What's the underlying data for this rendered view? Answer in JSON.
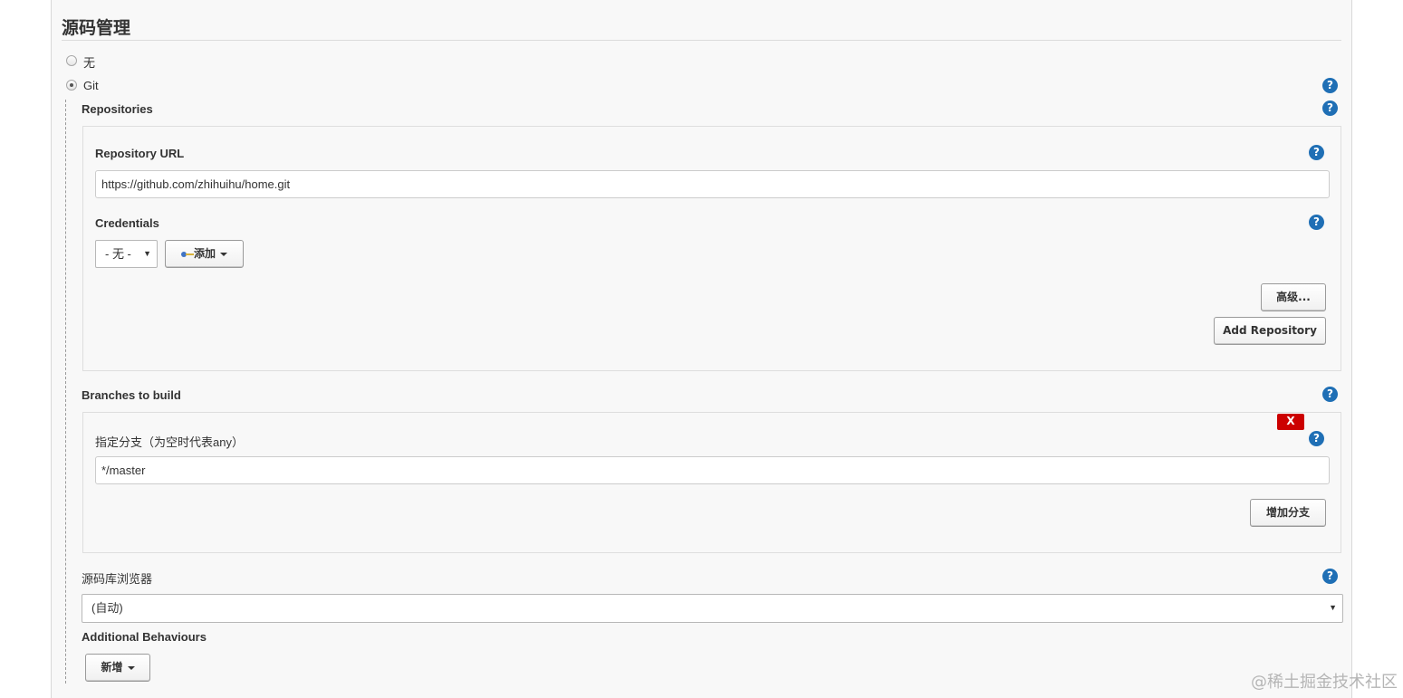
{
  "section": {
    "title": "源码管理"
  },
  "scm": {
    "options": [
      {
        "label": "无",
        "selected": false
      },
      {
        "label": "Git",
        "selected": true
      }
    ]
  },
  "help_glyph": "?",
  "repositories": {
    "label": "Repositories",
    "url_label": "Repository URL",
    "url_value": "https://github.com/zhihuihu/home.git",
    "credentials_label": "Credentials",
    "credentials_select": "- 无 -",
    "add_button": "添加",
    "advanced_button": "高级...",
    "add_repository_button": "Add Repository"
  },
  "branches": {
    "label": "Branches to build",
    "delete_button": "X",
    "specifier_label": "指定分支（为空时代表any）",
    "specifier_value": "*/master",
    "add_branch_button": "增加分支"
  },
  "browser": {
    "label": "源码库浏览器",
    "value": "(自动)"
  },
  "behaviours": {
    "label": "Additional Behaviours",
    "add_button": "新增"
  },
  "watermark": "@稀土掘金技术社区",
  "colors": {
    "help_blue": "#1f6fb5",
    "delete_red": "#cc0000",
    "panel_bg": "#f8f8f8"
  },
  "icons": [
    "radio-icon",
    "help-icon",
    "key-icon",
    "dropdown-caret-icon"
  ]
}
